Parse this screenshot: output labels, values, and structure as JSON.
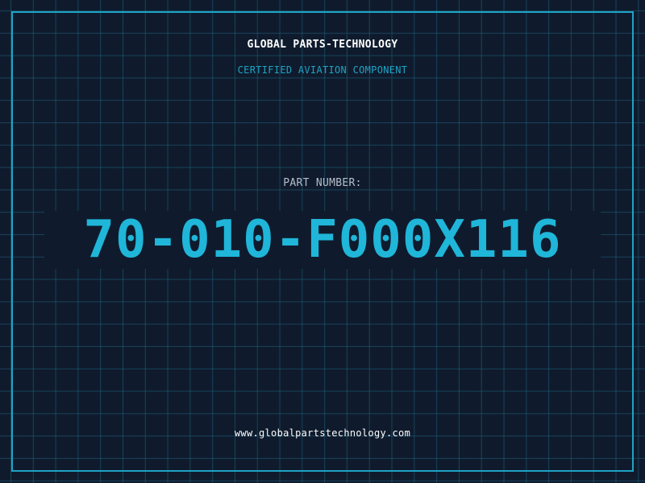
{
  "header": {
    "company": "GLOBAL PARTS-TECHNOLOGY",
    "subtitle": "CERTIFIED AVIATION COMPONENT"
  },
  "part": {
    "label": "PART NUMBER:",
    "number": "70-010-F000X116"
  },
  "footer": {
    "website": "www.globalpartstechnology.com"
  },
  "colors": {
    "background": "#0f1b2d",
    "accent": "#1fb6d9",
    "grid": "#2682a0"
  }
}
